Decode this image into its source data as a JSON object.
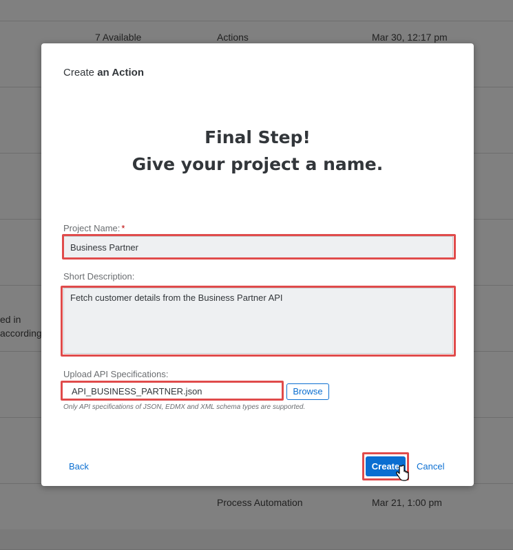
{
  "background": {
    "rows": [
      {
        "availability": "7 Available",
        "type": "Actions",
        "date": "Mar 30, 12:17 pm"
      },
      {
        "type": "Process Automation",
        "date": "Mar 21, 1:00 pm"
      }
    ],
    "side_text": [
      "ed in",
      "according"
    ]
  },
  "dialog": {
    "title_prefix": "Create",
    "title_bold": "an Action",
    "heading_line1": "Final Step!",
    "heading_line2": "Give your project a name.",
    "project_name_label": "Project Name:",
    "required_mark": "*",
    "project_name_value": "Business Partner",
    "short_description_label": "Short Description:",
    "short_description_value": "Fetch customer details from the Business Partner API",
    "upload_label": "Upload API Specifications:",
    "upload_file_value": "API_BUSINESS_PARTNER.json",
    "browse_label": "Browse",
    "upload_hint": "Only API specifications of JSON, EDMX and XML schema types are supported.",
    "back_label": "Back",
    "create_label": "Create",
    "cancel_label": "Cancel"
  },
  "colors": {
    "accent": "#0a6ed1",
    "highlight": "#e04b4b",
    "field_bg": "#eef0f2"
  }
}
